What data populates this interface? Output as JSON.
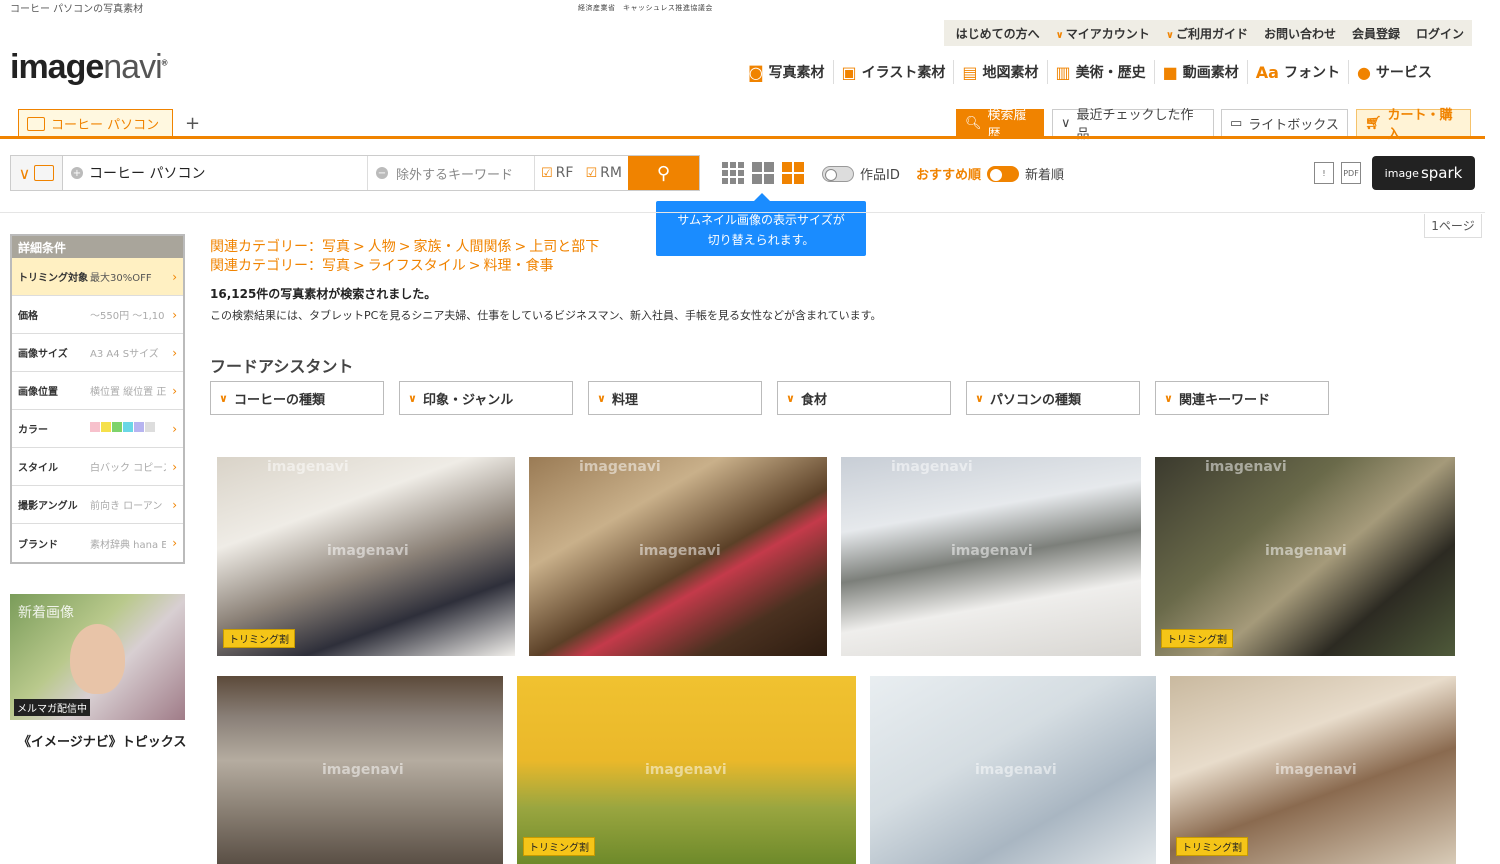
{
  "header": {
    "site_caption": "コーヒー パソコンの写真素材",
    "center_caption": "経済産業省　キャッシュレス推進協議会",
    "logo_bold": "image",
    "logo_light": "navi",
    "util_links": [
      "はじめての方へ",
      "マイアカウント",
      "ご利用ガイド",
      "お問い合わせ",
      "会員登録",
      "ログイン"
    ],
    "main_nav": [
      {
        "label": "写真素材",
        "icon": "camera-icon"
      },
      {
        "label": "イラスト素材",
        "icon": "picture-icon"
      },
      {
        "label": "地図素材",
        "icon": "map-icon"
      },
      {
        "label": "美術・歴史",
        "icon": "art-icon"
      },
      {
        "label": "動画素材",
        "icon": "video-icon"
      },
      {
        "label": "フォント",
        "icon": "font-icon"
      },
      {
        "label": "サービス",
        "icon": "person-icon"
      }
    ]
  },
  "tabs": {
    "search_tab": "コーヒー パソコン",
    "add_tab": "+"
  },
  "toolbar": {
    "history": "検索履歴",
    "recent": "最近チェックした作品",
    "lightbox": "ライトボックス",
    "cart": "カート・購入"
  },
  "search": {
    "keyword": "コーヒー パソコン",
    "exclude_placeholder": "除外するキーワード",
    "rf_label": "RF",
    "rm_label": "RM"
  },
  "options": {
    "work_id_label": "作品ID",
    "sort_recommended": "おすすめ順",
    "sort_new": "新着順",
    "pdf_label": "PDF",
    "spark_small": "image",
    "spark_big": "spark"
  },
  "tooltip": {
    "line1": "サムネイル画像の表示サイズが",
    "line2": "切り替えられます。"
  },
  "page_indicator": "1ページ",
  "sidebar": {
    "title": "詳細条件",
    "rows": [
      {
        "key": "トリミング対象",
        "value": "最大30%OFF"
      },
      {
        "key": "価格",
        "value": "～550円 ～1,10"
      },
      {
        "key": "画像サイズ",
        "value": "A3 A4 Sサイズ"
      },
      {
        "key": "画像位置",
        "value": "横位置 縦位置 正"
      },
      {
        "key": "カラー",
        "value": ""
      },
      {
        "key": "スタイル",
        "value": "白バック コピース"
      },
      {
        "key": "撮影アングル",
        "value": "前向き ローアン"
      },
      {
        "key": "ブランド",
        "value": "素材辞典 hana E"
      }
    ],
    "swatch_colors": [
      "#f7c1cc",
      "#f5e04a",
      "#7ed36b",
      "#6ad7e6",
      "#b7b4f0",
      "#dddddd"
    ]
  },
  "promo": {
    "label": "新着画像",
    "mag": "メルマガ配信中",
    "topics": "《イメージナビ》トピックス"
  },
  "results": {
    "related1": [
      "関連カテゴリー：写真",
      "人物",
      "家族・人間関係",
      "上司と部下"
    ],
    "related2": [
      "関連カテゴリー：写真",
      "ライフスタイル",
      "料理・食事"
    ],
    "count": "16,125件の写真素材が検索されました。",
    "description": "この検索結果には、タブレットPCを見るシニア夫婦、仕事をしているビジネスマン、新入社員、手帳を見る女性などが含まれています。",
    "food_assistant": "フードアシスタント",
    "food_buttons": [
      "コーヒーの種類",
      "印象・ジャンル",
      "料理",
      "食材",
      "パソコンの種類",
      "関連キーワード"
    ],
    "trim_badge": "トリミング割",
    "watermark": "imagenavi"
  }
}
